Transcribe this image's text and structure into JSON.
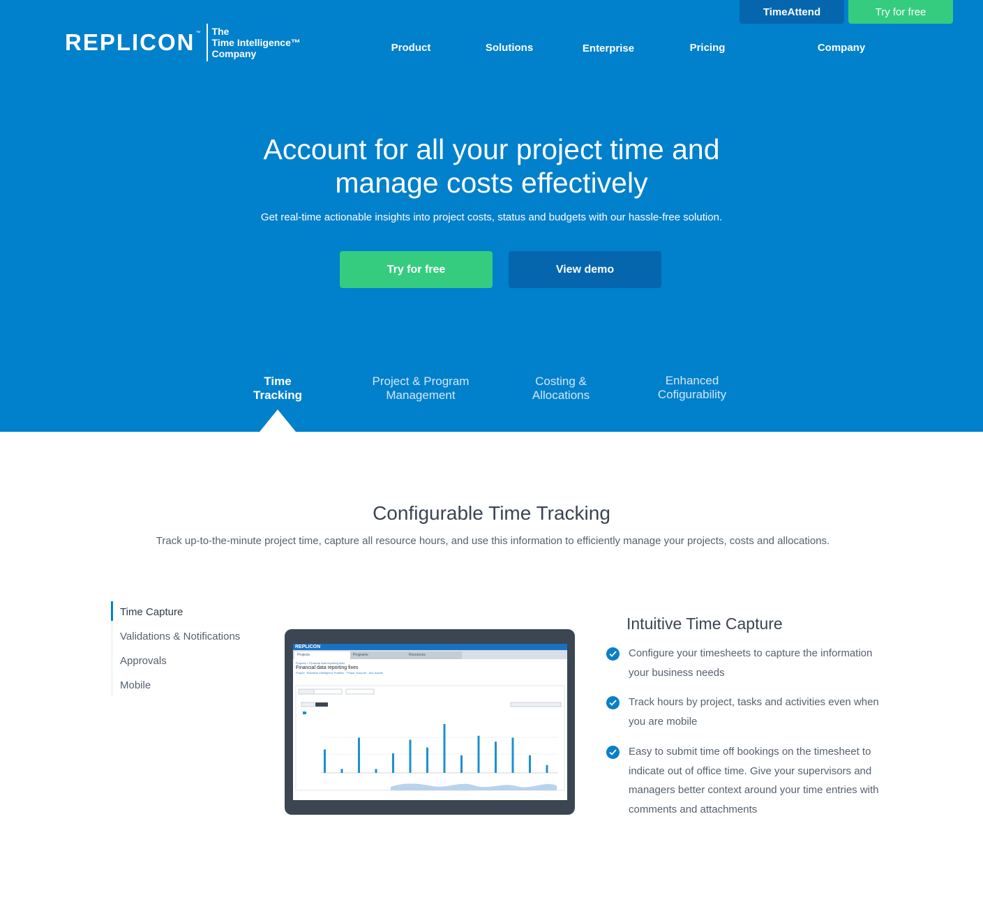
{
  "header": {
    "timeattend_label": "TimeAttend",
    "try_label": "Try for free",
    "logo_word": "REPLICON",
    "logo_tm": "™",
    "logo_tagline": [
      "The",
      "Time Intelligence™",
      "Company"
    ],
    "nav": [
      "Product",
      "Solutions",
      "Enterprise",
      "Pricing",
      "Company"
    ]
  },
  "hero": {
    "title_line1": "Account for all your project time and",
    "title_line2": "manage costs effectively",
    "subtitle": "Get real-time actionable insights into project costs, status and budgets with our hassle-free solution.",
    "try_label": "Try for free",
    "demo_label": "View demo",
    "tabs": [
      {
        "line1": "Time",
        "line2": "Tracking"
      },
      {
        "line1": "Project & Program",
        "line2": "Management"
      },
      {
        "line1": "Costing &",
        "line2": "Allocations"
      },
      {
        "line1": "Enhanced",
        "line2": "Cofigurability"
      }
    ]
  },
  "section": {
    "title": "Configurable Time Tracking",
    "subtitle": "Track up-to-the-minute project time, capture all resource hours, and use this information to efficiently manage your projects, costs and allocations."
  },
  "side_menu": [
    "Time Capture",
    "Validations & Notifications",
    "Approvals",
    "Mobile"
  ],
  "screenshot": {
    "logo": "REPLICON",
    "tabs": [
      "Projects",
      "Programs",
      "Resources"
    ],
    "crumb": "Projects > Financial data reporting fixes",
    "title": "Financial data reporting fixes",
    "meta": "Project · Business Intelligence Portfolio · Phase: Execute · SAL Assets",
    "bars": [
      12,
      2,
      18,
      2,
      10,
      17,
      13,
      25,
      9,
      19,
      16,
      18,
      9,
      4
    ]
  },
  "feature": {
    "title": "Intuitive Time Capture",
    "bullets": [
      "Configure your timesheets to capture the information your business needs",
      "Track hours by project, tasks and activities even when you are mobile",
      "Easy to submit time off bookings on the timesheet to indicate out of office time. Give your supervisors and managers better context around your time entries with comments and attachments"
    ]
  },
  "colors": {
    "brand_blue": "#0180cc",
    "dark_blue": "#0566ae",
    "green": "#35cc80"
  }
}
